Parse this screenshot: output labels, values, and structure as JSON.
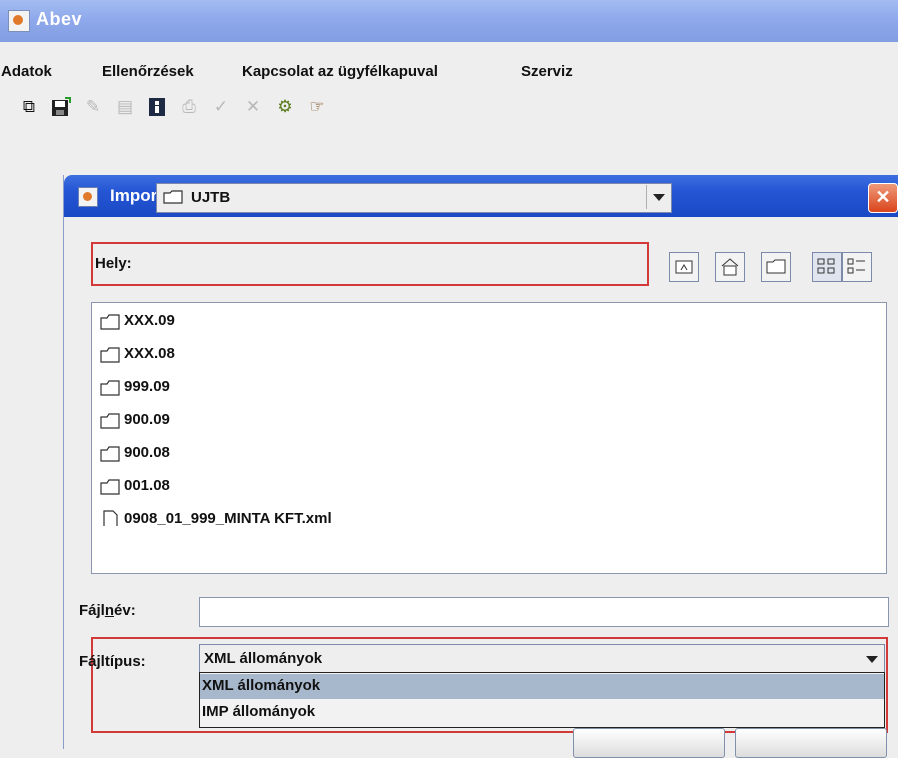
{
  "app": {
    "title": "Abev"
  },
  "menu": [
    "Adatok",
    "Ellenőrzések",
    "Kapcsolat az ügyfélkapuval",
    "Szerviz"
  ],
  "toolbar_icons": [
    {
      "name": "copy-icon",
      "enabled": true
    },
    {
      "name": "save-icon",
      "enabled": true
    },
    {
      "name": "edit-icon",
      "enabled": false
    },
    {
      "name": "document-icon",
      "enabled": false
    },
    {
      "name": "info-book-icon",
      "enabled": true
    },
    {
      "name": "print-icon",
      "enabled": false
    },
    {
      "name": "check-icon",
      "enabled": false
    },
    {
      "name": "delete-icon",
      "enabled": false
    },
    {
      "name": "gears-icon",
      "enabled": true
    },
    {
      "name": "pointing-hand-icon",
      "enabled": true
    }
  ],
  "dialog": {
    "title": "Import állomány kiválasztása",
    "location_label": "Hely:",
    "location_value": "UJTB",
    "files": [
      {
        "name": "XXX.09",
        "type": "folder"
      },
      {
        "name": "XXX.08",
        "type": "folder"
      },
      {
        "name": "999.09",
        "type": "folder"
      },
      {
        "name": "900.09",
        "type": "folder"
      },
      {
        "name": "900.08",
        "type": "folder"
      },
      {
        "name": "001.08",
        "type": "folder"
      },
      {
        "name": "0908_01_999_MINTA KFT.xml",
        "type": "file"
      }
    ],
    "filename_label_pre": "Fájl",
    "filename_label_mnemonic": "n",
    "filename_label_post": "év:",
    "filename_value": "",
    "filetype_label": "Fájltípus:",
    "filetype_value": "XML állományok",
    "filetype_options": [
      "XML állományok",
      "IMP állományok"
    ],
    "selected_option_index": 0
  },
  "colors": {
    "highlight_border": "#d23a3a",
    "dialog_titlebar": "#2455d4",
    "selected_option": "#a8b8cc"
  }
}
